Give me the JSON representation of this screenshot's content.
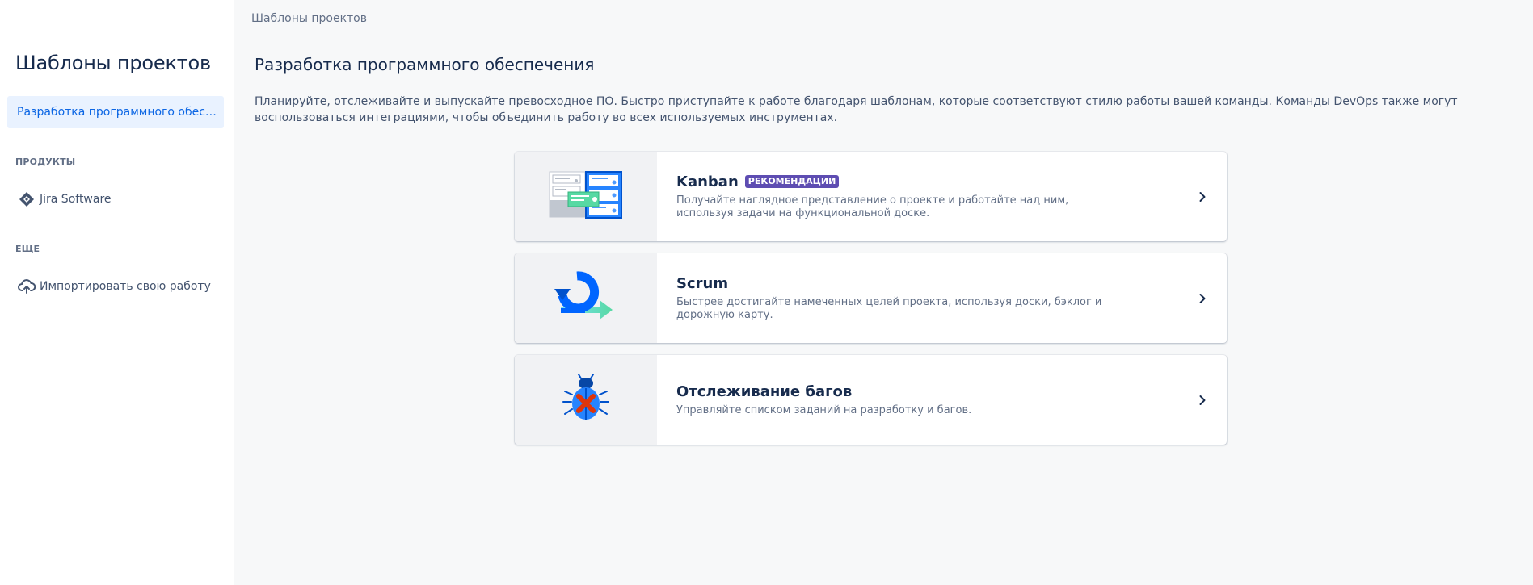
{
  "sidebar": {
    "title": "Шаблоны проектов",
    "selected_item": "Разработка программного обеспечения",
    "section_products": "ПРОДУКТЫ",
    "product_item": "Jira Software",
    "section_more": "ЕЩЕ",
    "import_item": "Импортировать свою работу"
  },
  "main": {
    "breadcrumb": "Шаблоны проектов",
    "title": "Разработка программного обеспечения",
    "description": "Планируйте, отслеживайте и выпускайте превосходное ПО. Быстро приступайте к работе благодаря шаблонам, которые соответствуют стилю работы вашей команды. Команды DevOps также могут воспользоваться интеграциями, чтобы объединить работу во всех используемых инструментах.",
    "cards": [
      {
        "title": "Kanban",
        "badge": "РЕКОМЕНДАЦИИ",
        "description": "Получайте наглядное представление о проекте и работайте над ним, используя задачи на функциональной доске.",
        "icon": "kanban-board-icon"
      },
      {
        "title": "Scrum",
        "description": "Быстрее достигайте намеченных целей проекта, используя доски, бэклог и дорожную карту.",
        "icon": "scrum-cycle-icon"
      },
      {
        "title": "Отслеживание багов",
        "description": "Управляйте списком заданий на разработку и багов.",
        "icon": "bug-icon"
      }
    ]
  },
  "colors": {
    "accent": "#0c66e4",
    "selected_bg": "#e9f2ff",
    "badge_bg": "#5e4db2",
    "text_primary": "#172b4d",
    "text_secondary": "#626f86"
  }
}
